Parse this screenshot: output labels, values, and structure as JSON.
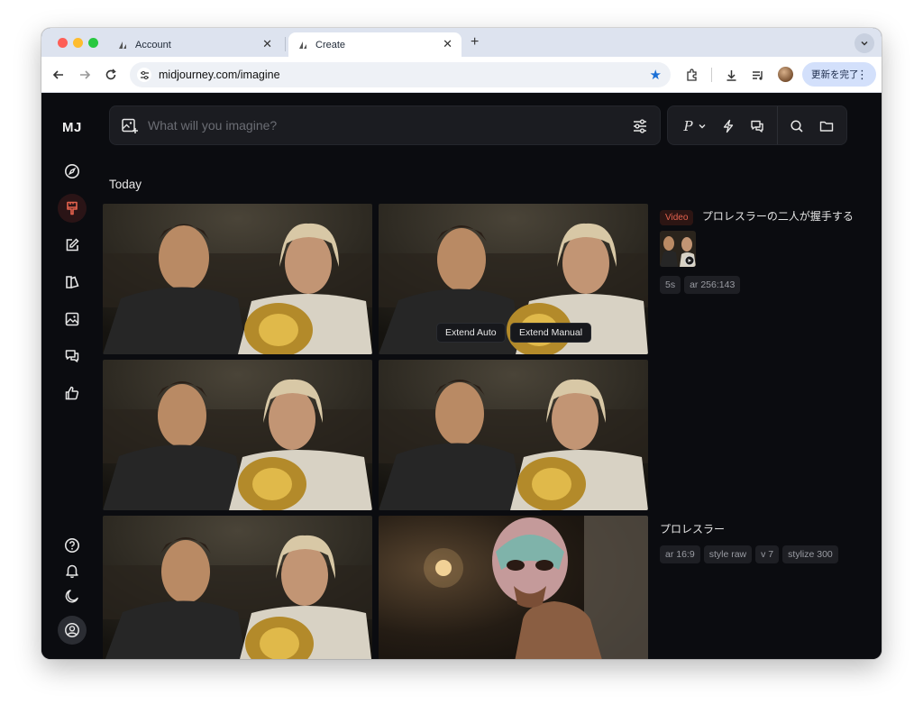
{
  "browser": {
    "tabs": [
      {
        "title": "Account",
        "close": "✕"
      },
      {
        "title": "Create",
        "close": "✕"
      }
    ],
    "new_tab": "+",
    "url": "midjourney.com/imagine",
    "update_button": "更新を完了"
  },
  "app": {
    "logo": "MJ",
    "sidebar_items": [
      "compass-icon",
      "brush-icon",
      "edit-icon",
      "layers-icon",
      "image-icon",
      "chat-icon",
      "thumbs-up-icon"
    ],
    "sidebar_bottom": [
      "help-icon",
      "bell-icon",
      "moon-icon",
      "account-icon"
    ],
    "prompt_placeholder": "What will you imagine?",
    "tool_personalize_label": "P",
    "section_title": "Today",
    "extend_auto": "Extend Auto",
    "extend_manual": "Extend Manual",
    "job1": {
      "badge": "Video",
      "title": "プロレスラーの二人が握手する",
      "chips": [
        "5s",
        "ar 256:143"
      ]
    },
    "job2": {
      "title": "プロレスラー",
      "chips": [
        "ar 16:9",
        "style raw",
        "v 7",
        "stylize 300"
      ]
    },
    "colors": {
      "accent": "#e5624e",
      "background": "#0b0c10",
      "panel": "#1b1c21"
    }
  }
}
